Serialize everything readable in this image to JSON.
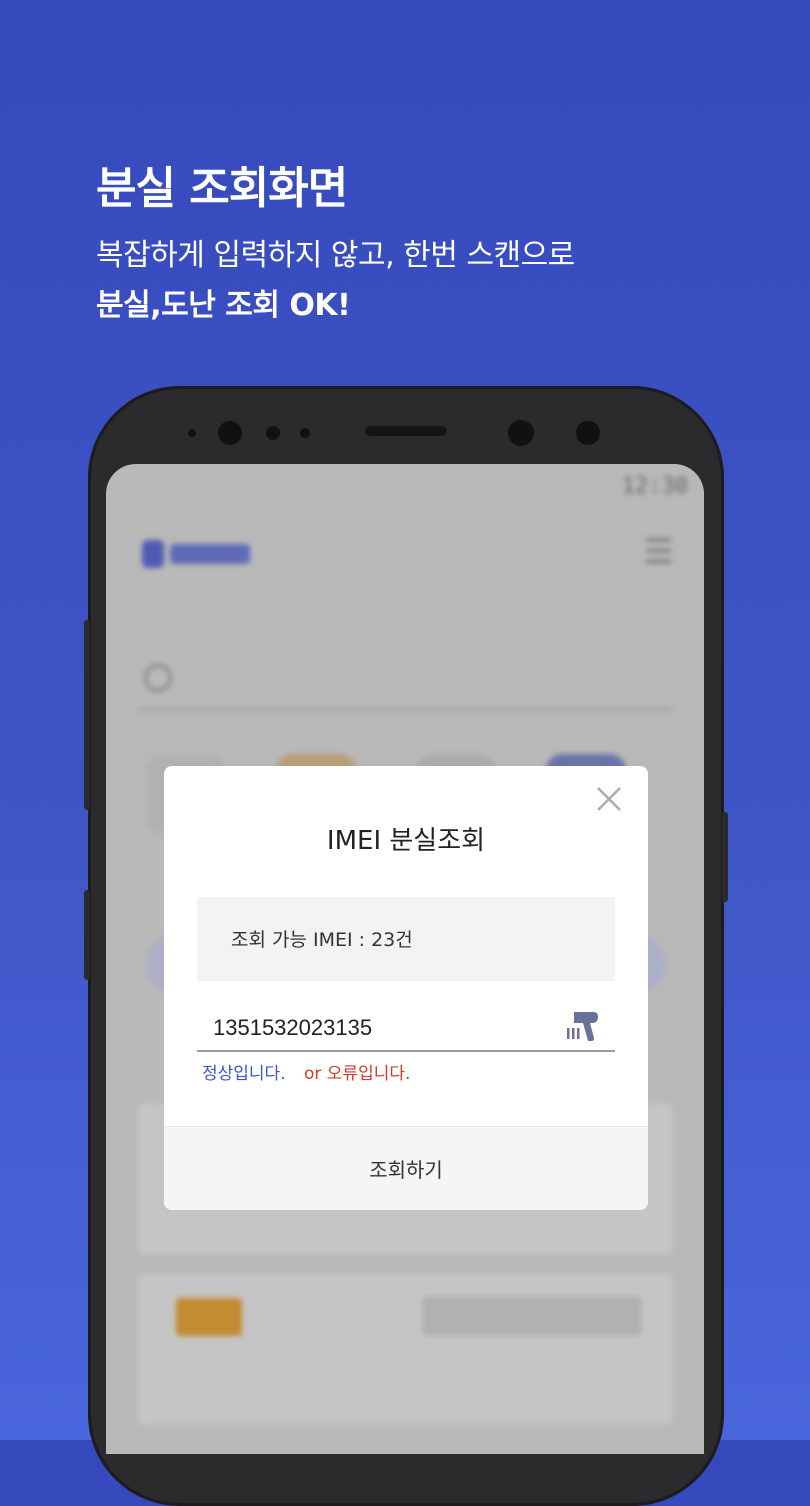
{
  "promo": {
    "title": "분실 조회화면",
    "line1": "복잡하게 입력하지 않고, 한번 스캔으로",
    "line2": "분실,도난 조회 OK!"
  },
  "status_bar": {
    "time": "12:30"
  },
  "modal": {
    "title": "IMEI 분실조회",
    "info_label": "조회 가능 IMEI : 23건",
    "imei_value": "1351532023135",
    "status_ok": "정상입니다.",
    "status_err": "or 오류입니다.",
    "submit_label": "조회하기"
  },
  "colors": {
    "background": "#3f55c6",
    "accent_blue": "#3d56c9",
    "error_red": "#d23a2a",
    "scanner_icon": "#6b7297"
  }
}
